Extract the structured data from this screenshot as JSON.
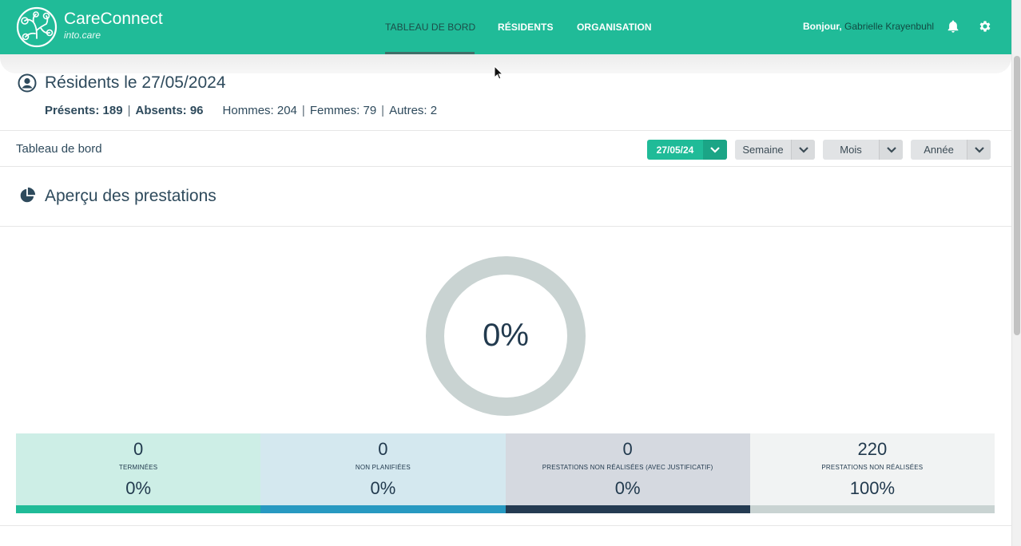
{
  "header": {
    "brand": "CareConnect",
    "brand_sub": "into.care",
    "nav": [
      {
        "label": "TABLEAU DE BORD",
        "active": true
      },
      {
        "label": "RÉSIDENTS",
        "active": false
      },
      {
        "label": "ORGANISATION",
        "active": false
      }
    ],
    "greeting_prefix": "Bonjour,",
    "user_name": "Gabrielle Krayenbuhl"
  },
  "residents": {
    "title": "Résidents le 27/05/2024",
    "present_label": "Présents:",
    "present_value": "189",
    "absent_label": "Absents:",
    "absent_value": "96",
    "men": "Hommes: 204",
    "women": "Femmes: 79",
    "others": "Autres: 2"
  },
  "toolbar": {
    "label": "Tableau de bord",
    "filters": [
      {
        "label": "27/05/24"
      },
      {
        "label": "Semaine"
      },
      {
        "label": "Mois"
      },
      {
        "label": "Année"
      }
    ]
  },
  "section": {
    "title": "Aperçu des prestations"
  },
  "donut": {
    "center_label": "0%",
    "completed_fraction": 0,
    "ring_color": "#c9d3d2"
  },
  "stats": [
    {
      "count": "0",
      "label": "TERMINÉES",
      "percent": "0%",
      "bg": "#cdeee6",
      "bar": "#20bb98"
    },
    {
      "count": "0",
      "label": "NON PLANIFIÉES",
      "percent": "0%",
      "bg": "#d4e8ef",
      "bar": "#2799c1"
    },
    {
      "count": "0",
      "label": "PRESTATIONS NON RÉALISÉES (AVEC JUSTIFICATIF)",
      "percent": "0%",
      "bg": "#d5d9e0",
      "bar": "#243b52"
    },
    {
      "count": "220",
      "label": "PRESTATIONS NON RÉALISÉES",
      "percent": "100%",
      "bg": "#f1f3f3",
      "bar": "#c9d3d2"
    }
  ]
}
